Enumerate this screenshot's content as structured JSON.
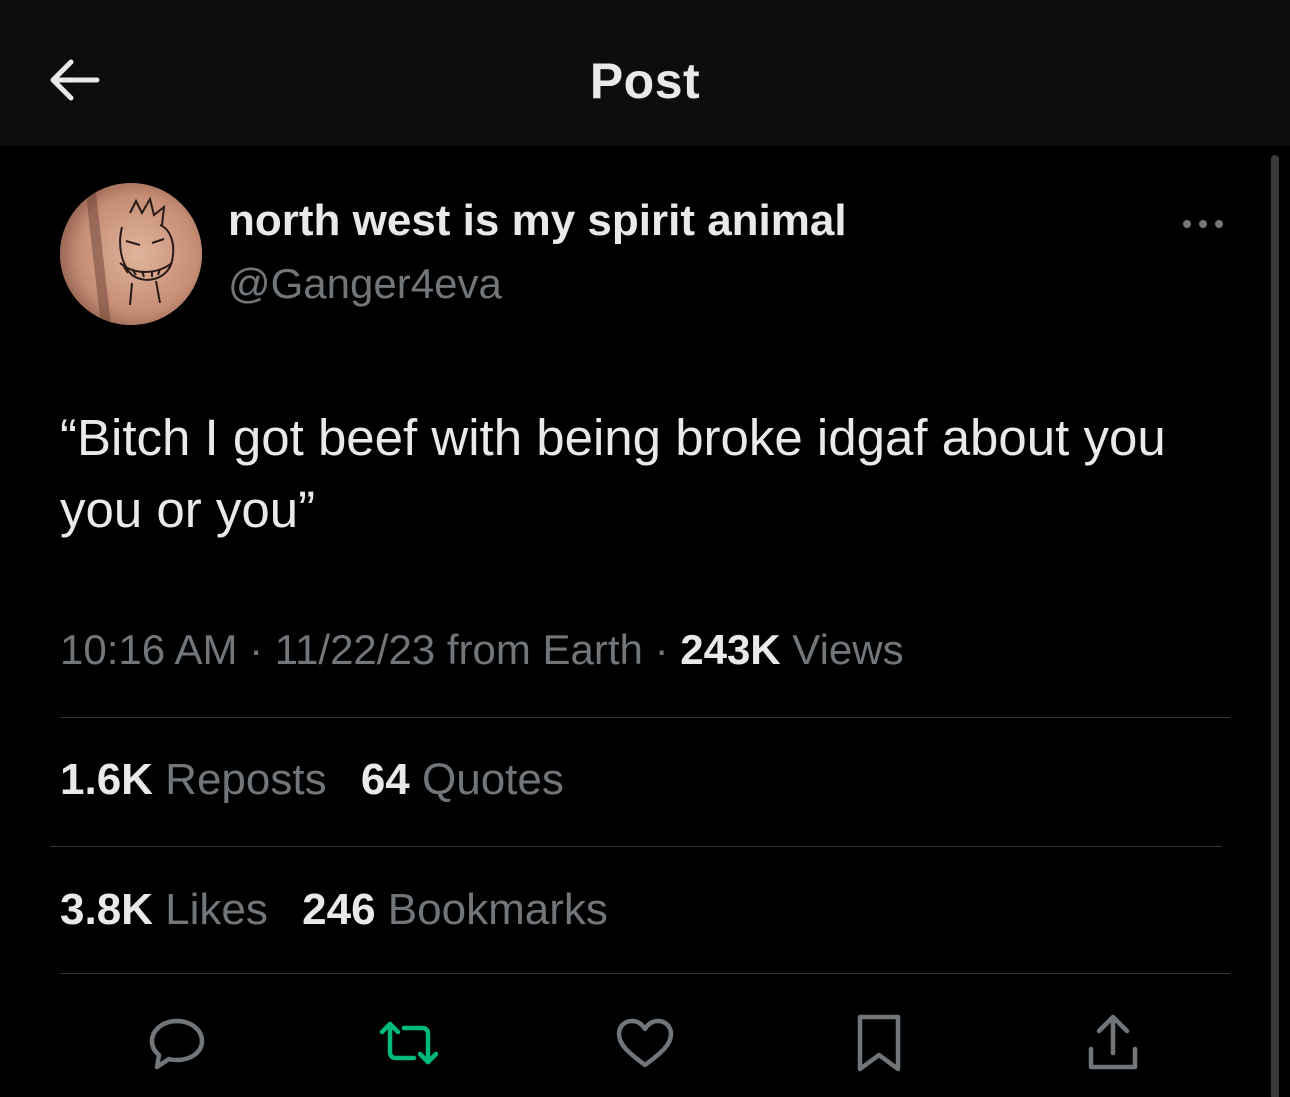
{
  "header": {
    "title": "Post",
    "back_icon": "arrow-left-icon"
  },
  "author": {
    "display_name": "north west is my spirit animal",
    "handle": "@Ganger4eva",
    "avatar_icon": "avatar-tattoo-image"
  },
  "tweet": {
    "text": "“Bitch I got beef with being broke idgaf about you you or you”"
  },
  "meta": {
    "time": "10:16 AM",
    "sep1": " · ",
    "date": "11/22/23",
    "source": " from Earth",
    "sep2": " · ",
    "views_count": "243K",
    "views_label": " Views"
  },
  "stats": {
    "reposts_count": "1.6K",
    "reposts_label": " Reposts",
    "quotes_count": "64",
    "quotes_label": " Quotes",
    "likes_count": "3.8K",
    "likes_label": " Likes",
    "bookmarks_count": "246",
    "bookmarks_label": " Bookmarks"
  },
  "actions": [
    {
      "name": "reply",
      "icon": "reply-icon"
    },
    {
      "name": "repost",
      "icon": "repost-icon"
    },
    {
      "name": "like",
      "icon": "heart-icon"
    },
    {
      "name": "bookmark",
      "icon": "bookmark-icon"
    },
    {
      "name": "share",
      "icon": "share-icon"
    }
  ],
  "colors": {
    "background": "#000000",
    "header_bg": "#0d0d0d",
    "primary_text": "#e7e9ea",
    "secondary_text": "#71767b",
    "repost_accent": "#00ba7c",
    "divider": "#2f3336"
  }
}
